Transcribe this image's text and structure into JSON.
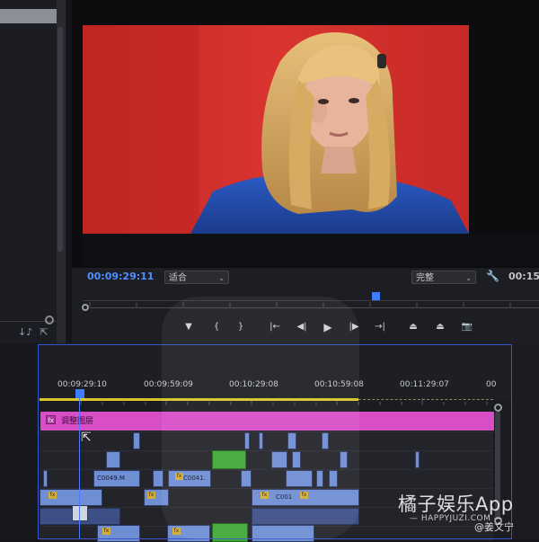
{
  "monitor": {
    "timecode": "00:09:29:11",
    "zoom_select": "适合",
    "quality_select": "完整",
    "end_timecode": "00:15"
  },
  "playback_controls": [
    {
      "icon": "marker-icon",
      "glyph": "▼"
    },
    {
      "icon": "mark-in-icon",
      "glyph": "{"
    },
    {
      "icon": "mark-out-icon",
      "glyph": "}"
    },
    {
      "icon": "go-to-in-icon",
      "glyph": "|←"
    },
    {
      "icon": "step-back-icon",
      "glyph": "◀|"
    },
    {
      "icon": "play-icon",
      "glyph": "▶"
    },
    {
      "icon": "step-forward-icon",
      "glyph": "|▶"
    },
    {
      "icon": "go-to-out-icon",
      "glyph": "→|"
    },
    {
      "icon": "lift-icon",
      "glyph": "⏏"
    },
    {
      "icon": "extract-icon",
      "glyph": "⏏"
    },
    {
      "icon": "export-frame-icon",
      "glyph": "📷"
    }
  ],
  "timeline": {
    "ruler_timecodes": [
      "00:09:29:10",
      "00:09:59:09",
      "00:10:29:08",
      "00:10:59:08",
      "00:11:29:07",
      "00"
    ],
    "adjustment_layer_label": "调整图层",
    "adjustment_fx": "fx",
    "clip_labels": [
      "C0049.M",
      "C0041.",
      "C001"
    ]
  },
  "watermark": {
    "brand": "橘子娱乐App",
    "site": "— HAPPYJUZI.COM —",
    "weibo_glyph": "@",
    "user": "@姜文宁"
  },
  "colors": {
    "timecode": "#4d8fff",
    "adjustment_layer": "#d84ec7",
    "clip_blue": "#6f8fd4",
    "clip_green": "#3fa836",
    "video_background": "#d1312c"
  }
}
